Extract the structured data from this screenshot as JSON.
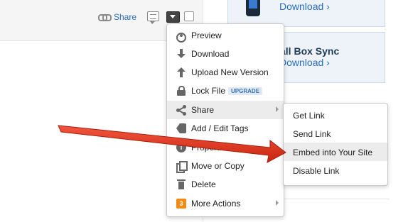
{
  "toolbar": {
    "share_label": "Share",
    "icons": [
      "link-icon",
      "comment-icon",
      "dropdown-icon",
      "checkbox"
    ]
  },
  "promos": [
    {
      "link": "Download ›"
    },
    {
      "title": "nstall Box Sync",
      "link": "Download ›"
    }
  ],
  "menu": {
    "items": [
      {
        "label": "Preview",
        "icon": "eye-icon"
      },
      {
        "label": "Download",
        "icon": "download-arrow-icon"
      },
      {
        "label": "Upload New Version",
        "icon": "upload-arrow-icon"
      },
      {
        "label": "Lock File",
        "icon": "lock-icon",
        "badge": "UPGRADE"
      },
      {
        "label": "Share",
        "icon": "share-icon",
        "submenu": true,
        "active": true
      },
      {
        "label": "Add / Edit Tags",
        "icon": "tag-icon"
      },
      {
        "label": "Properties",
        "icon": "info-icon",
        "icon_text": "i"
      },
      {
        "label": "Move or Copy",
        "icon": "copy-icon"
      },
      {
        "label": "Delete",
        "icon": "trash-icon"
      },
      {
        "label": "More Actions",
        "icon": "count-badge",
        "icon_text": "3",
        "submenu": true
      }
    ]
  },
  "share_submenu": {
    "items": [
      {
        "label": "Get Link"
      },
      {
        "label": "Send Link"
      },
      {
        "label": "Embed into Your Site",
        "highlighted": true
      },
      {
        "label": "Disable Link"
      }
    ]
  },
  "colors": {
    "link": "#2a6ebd",
    "annotation_arrow": "#e8321c",
    "badge_orange": "#f28a14"
  }
}
